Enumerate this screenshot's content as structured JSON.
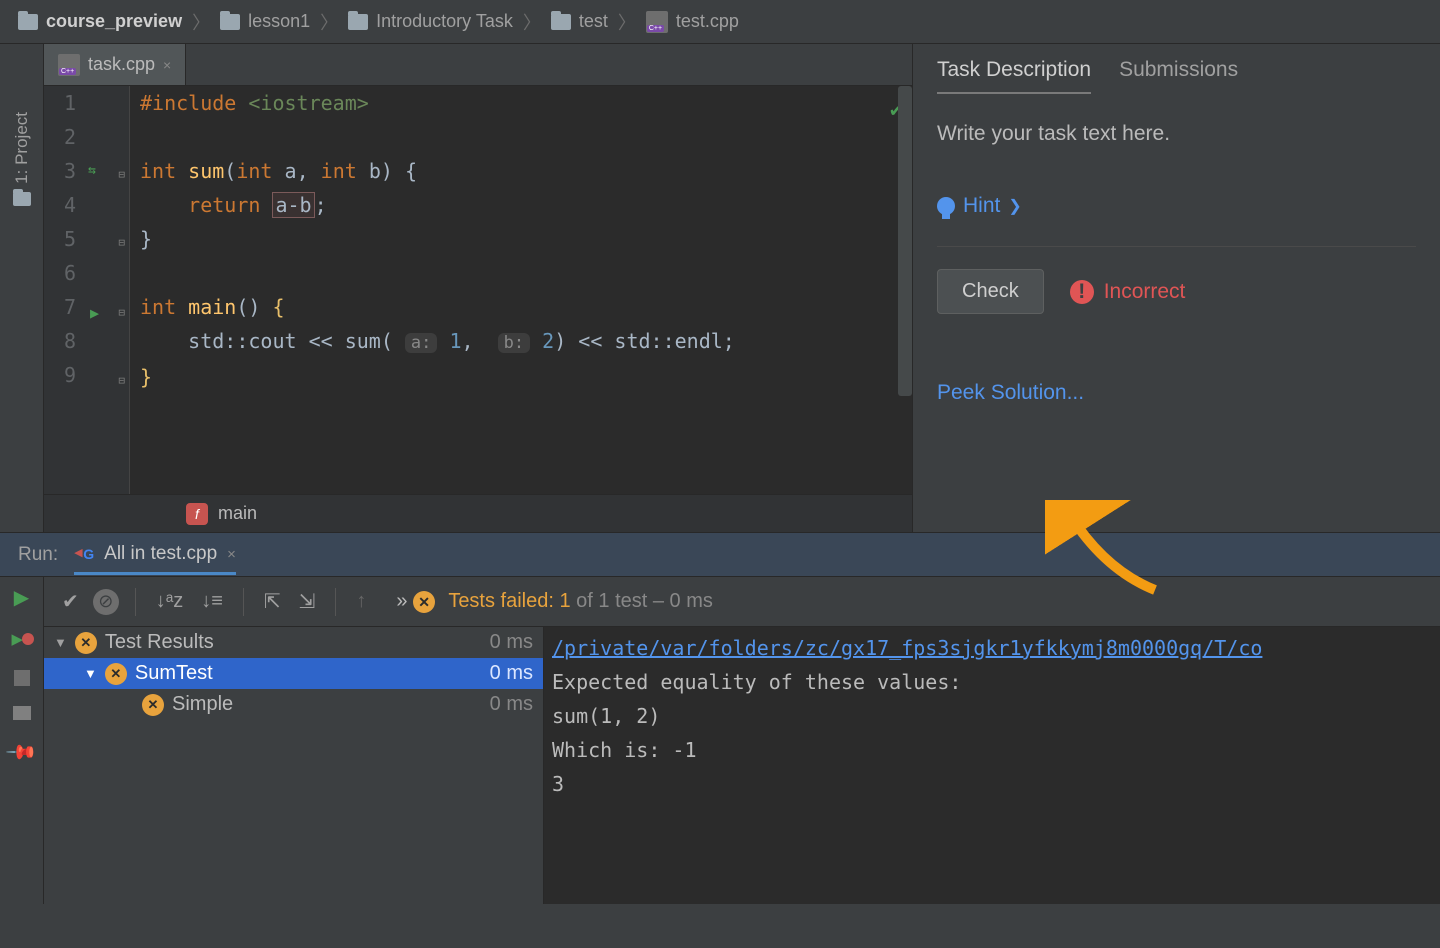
{
  "breadcrumb": {
    "items": [
      {
        "label": "course_preview",
        "bold": true,
        "icon": "folder"
      },
      {
        "label": "lesson1",
        "icon": "folder"
      },
      {
        "label": "Introductory Task",
        "icon": "folder"
      },
      {
        "label": "test",
        "icon": "folder"
      },
      {
        "label": "test.cpp",
        "icon": "cpp"
      }
    ]
  },
  "left_sidebar": {
    "project_label": "1: Project"
  },
  "editor": {
    "tab_label": "task.cpp",
    "lines": [
      "1",
      "2",
      "3",
      "4",
      "5",
      "6",
      "7",
      "8",
      "9"
    ],
    "code": {
      "l1_include": "#include",
      "l1_header": "<iostream>",
      "l3_kw1": "int",
      "l3_fn": "sum",
      "l3_params": "int a, int b",
      "l4_return": "return",
      "l4_expr": "a-b",
      "l7_kw1": "int",
      "l7_fn": "main",
      "l8_cout": "std::cout << sum(",
      "l8_hint1": "a:",
      "l8_v1": "1",
      "l8_hint2": "b:",
      "l8_v2": "2",
      "l8_tail": ") << std::endl;"
    },
    "bottom_breadcrumb": "main"
  },
  "task_panel": {
    "tabs": [
      "Task Description",
      "Submissions"
    ],
    "body_text": "Write your task text here.",
    "hint_label": "Hint",
    "check_label": "Check",
    "status_label": "Incorrect",
    "peek_label": "Peek Solution..."
  },
  "run": {
    "label": "Run:",
    "target": "All in test.cpp",
    "summary_prefix": "Tests failed:",
    "summary_num": "1",
    "summary_rest": "of 1 test – 0 ms",
    "arrows": "»"
  },
  "test_tree": {
    "rows": [
      {
        "name": "Test Results",
        "time": "0 ms",
        "depth": 0
      },
      {
        "name": "SumTest",
        "time": "0 ms",
        "depth": 1,
        "selected": true
      },
      {
        "name": "Simple",
        "time": "0 ms",
        "depth": 2
      }
    ]
  },
  "console": {
    "link": "/private/var/folders/zc/gx17_fps3sjgkr1yfkkymj8m0000gq/T/co",
    "l2": "Expected equality of these values:",
    "l3": "  sum(1, 2)",
    "l4": "    Which is: -1",
    "l5": "  3"
  }
}
